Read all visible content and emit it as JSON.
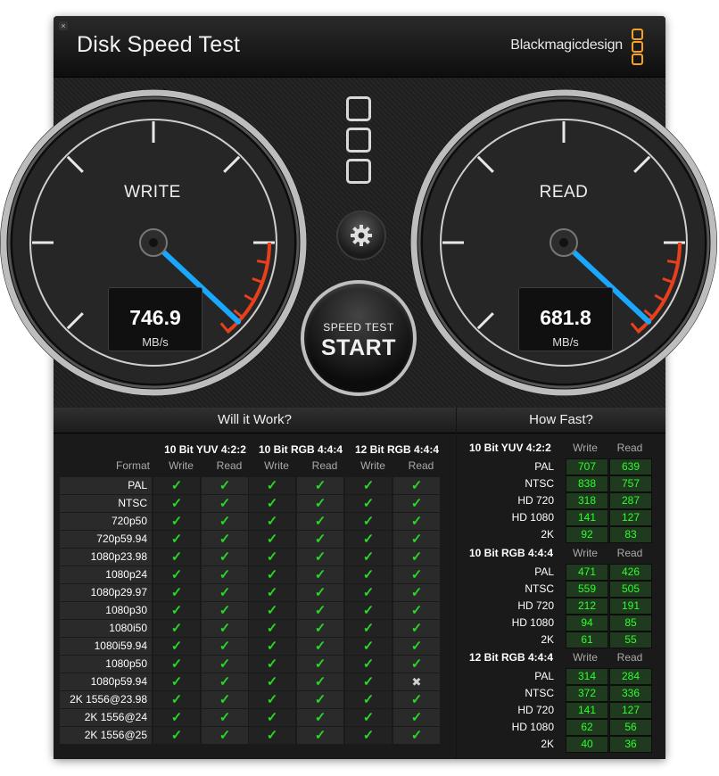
{
  "window": {
    "title": "Disk Speed Test",
    "brand": "Blackmagicdesign",
    "close_glyph": "×",
    "brand_color": "#f4a12a"
  },
  "gauges": {
    "write": {
      "label": "WRITE",
      "value": "746.9",
      "unit": "MB/s"
    },
    "read": {
      "label": "READ",
      "value": "681.8",
      "unit": "MB/s"
    },
    "needle_color": "#1aa8ff",
    "redzone_color": "#e8401c"
  },
  "controls": {
    "settings_icon": "gear-icon",
    "start_sub": "SPEED TEST",
    "start_main": "START"
  },
  "will_it_work": {
    "title": "Will it Work?",
    "format_label": "Format",
    "groups": [
      "10 Bit YUV 4:2:2",
      "10 Bit RGB 4:4:4",
      "12 Bit RGB 4:4:4"
    ],
    "col_labels": [
      "Write",
      "Read"
    ],
    "check_glyph": "✓",
    "cross_glyph": "✖",
    "rows": [
      {
        "format": "PAL",
        "ok": [
          true,
          true,
          true,
          true,
          true,
          true
        ]
      },
      {
        "format": "NTSC",
        "ok": [
          true,
          true,
          true,
          true,
          true,
          true
        ]
      },
      {
        "format": "720p50",
        "ok": [
          true,
          true,
          true,
          true,
          true,
          true
        ]
      },
      {
        "format": "720p59.94",
        "ok": [
          true,
          true,
          true,
          true,
          true,
          true
        ]
      },
      {
        "format": "1080p23.98",
        "ok": [
          true,
          true,
          true,
          true,
          true,
          true
        ]
      },
      {
        "format": "1080p24",
        "ok": [
          true,
          true,
          true,
          true,
          true,
          true
        ]
      },
      {
        "format": "1080p29.97",
        "ok": [
          true,
          true,
          true,
          true,
          true,
          true
        ]
      },
      {
        "format": "1080p30",
        "ok": [
          true,
          true,
          true,
          true,
          true,
          true
        ]
      },
      {
        "format": "1080i50",
        "ok": [
          true,
          true,
          true,
          true,
          true,
          true
        ]
      },
      {
        "format": "1080i59.94",
        "ok": [
          true,
          true,
          true,
          true,
          true,
          true
        ]
      },
      {
        "format": "1080p50",
        "ok": [
          true,
          true,
          true,
          true,
          true,
          true
        ]
      },
      {
        "format": "1080p59.94",
        "ok": [
          true,
          true,
          true,
          true,
          true,
          false
        ]
      },
      {
        "format": "2K 1556@23.98",
        "ok": [
          true,
          true,
          true,
          true,
          true,
          true
        ]
      },
      {
        "format": "2K 1556@24",
        "ok": [
          true,
          true,
          true,
          true,
          true,
          true
        ]
      },
      {
        "format": "2K 1556@25",
        "ok": [
          true,
          true,
          true,
          true,
          true,
          true
        ]
      }
    ]
  },
  "how_fast": {
    "title": "How Fast?",
    "col_labels": [
      "Write",
      "Read"
    ],
    "groups": [
      {
        "name": "10 Bit YUV 4:2:2",
        "rows": [
          {
            "label": "PAL",
            "write": "707",
            "read": "639"
          },
          {
            "label": "NTSC",
            "write": "838",
            "read": "757"
          },
          {
            "label": "HD 720",
            "write": "318",
            "read": "287"
          },
          {
            "label": "HD 1080",
            "write": "141",
            "read": "127"
          },
          {
            "label": "2K",
            "write": "92",
            "read": "83"
          }
        ]
      },
      {
        "name": "10 Bit RGB 4:4:4",
        "rows": [
          {
            "label": "PAL",
            "write": "471",
            "read": "426"
          },
          {
            "label": "NTSC",
            "write": "559",
            "read": "505"
          },
          {
            "label": "HD 720",
            "write": "212",
            "read": "191"
          },
          {
            "label": "HD 1080",
            "write": "94",
            "read": "85"
          },
          {
            "label": "2K",
            "write": "61",
            "read": "55"
          }
        ]
      },
      {
        "name": "12 Bit RGB 4:4:4",
        "rows": [
          {
            "label": "PAL",
            "write": "314",
            "read": "284"
          },
          {
            "label": "NTSC",
            "write": "372",
            "read": "336"
          },
          {
            "label": "HD 720",
            "write": "141",
            "read": "127"
          },
          {
            "label": "HD 1080",
            "write": "62",
            "read": "56"
          },
          {
            "label": "2K",
            "write": "40",
            "read": "36"
          }
        ]
      }
    ]
  }
}
